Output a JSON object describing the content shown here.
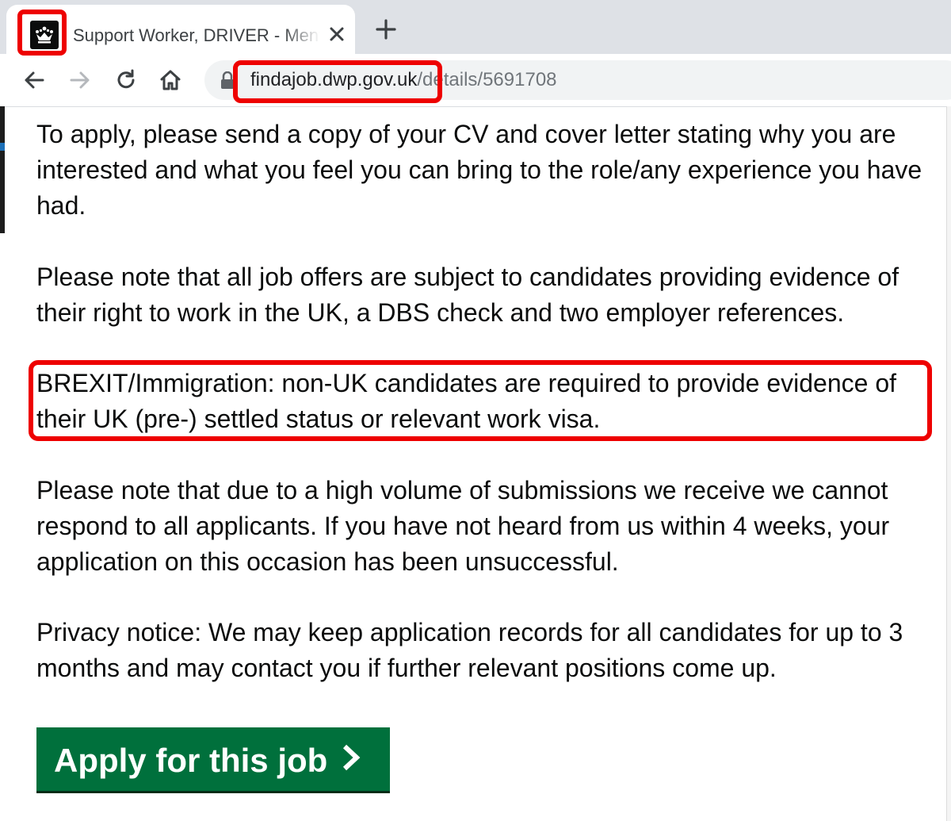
{
  "browser": {
    "tab": {
      "title": "Support Worker, DRIVER - Mental Health",
      "favicon": "crown-icon",
      "close_icon": "close-icon"
    },
    "new_tab_icon": "plus-icon",
    "nav": {
      "back_icon": "arrow-left-icon",
      "forward_icon": "arrow-right-icon",
      "reload_icon": "reload-icon",
      "home_icon": "home-icon"
    },
    "address": {
      "lock_icon": "lock-icon",
      "domain": "findajob.dwp.gov.uk",
      "path": "/details/5691708"
    }
  },
  "content": {
    "paragraphs": [
      "To apply, please send a copy of your CV and cover letter stating why you are interested and what you feel you can bring to the role/any experience you have had.",
      "Please note that all job offers are subject to candidates providing evidence of their right to work in the UK, a DBS check and two employer references.",
      "BREXIT/Immigration: non-UK candidates are required to provide evidence of their UK (pre-) settled status or relevant work visa.",
      "Please note that due to a high volume of submissions we receive we cannot respond to all applicants. If you have not heard from us within 4 weeks, your application on this occasion has been unsuccessful.",
      "Privacy notice: We may keep application records for all candidates for up to 3 months and may contact you if further relevant positions come up."
    ],
    "apply_button": {
      "label": "Apply for this job",
      "icon": "chevron-right-icon"
    }
  },
  "colors": {
    "highlight": "#ee0000",
    "apply_green": "#00703c",
    "tabstrip": "#dee1e6"
  }
}
